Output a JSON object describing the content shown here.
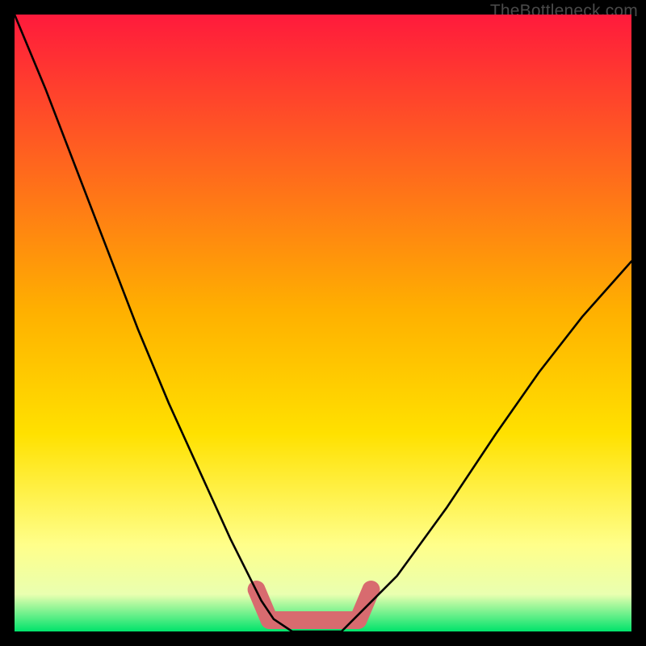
{
  "watermark": "TheBottleneck.com",
  "colors": {
    "bg": "#000000",
    "grad_top": "#ff1a3c",
    "grad_mid": "#ffd300",
    "grad_low": "#ffff7a",
    "grad_bottom": "#00e36b",
    "curve": "#000000",
    "band": "#d86b6f"
  },
  "chart_data": {
    "type": "line",
    "x": [
      0,
      0.05,
      0.1,
      0.15,
      0.2,
      0.25,
      0.3,
      0.35,
      0.38,
      0.4,
      0.42,
      0.45,
      0.48,
      0.5,
      0.53,
      0.55,
      0.58,
      0.62,
      0.7,
      0.78,
      0.85,
      0.92,
      1.0
    ],
    "y": [
      1.0,
      0.88,
      0.75,
      0.62,
      0.49,
      0.37,
      0.26,
      0.15,
      0.09,
      0.05,
      0.02,
      0.0,
      0.0,
      0.0,
      0.0,
      0.02,
      0.05,
      0.09,
      0.2,
      0.32,
      0.42,
      0.51,
      0.6
    ],
    "ylim": [
      0,
      1
    ],
    "xlim": [
      0,
      1
    ],
    "title": "",
    "xlabel": "",
    "ylabel": "",
    "highlight_band": {
      "x_start": 0.4,
      "x_end": 0.57,
      "y": 0.0
    }
  }
}
